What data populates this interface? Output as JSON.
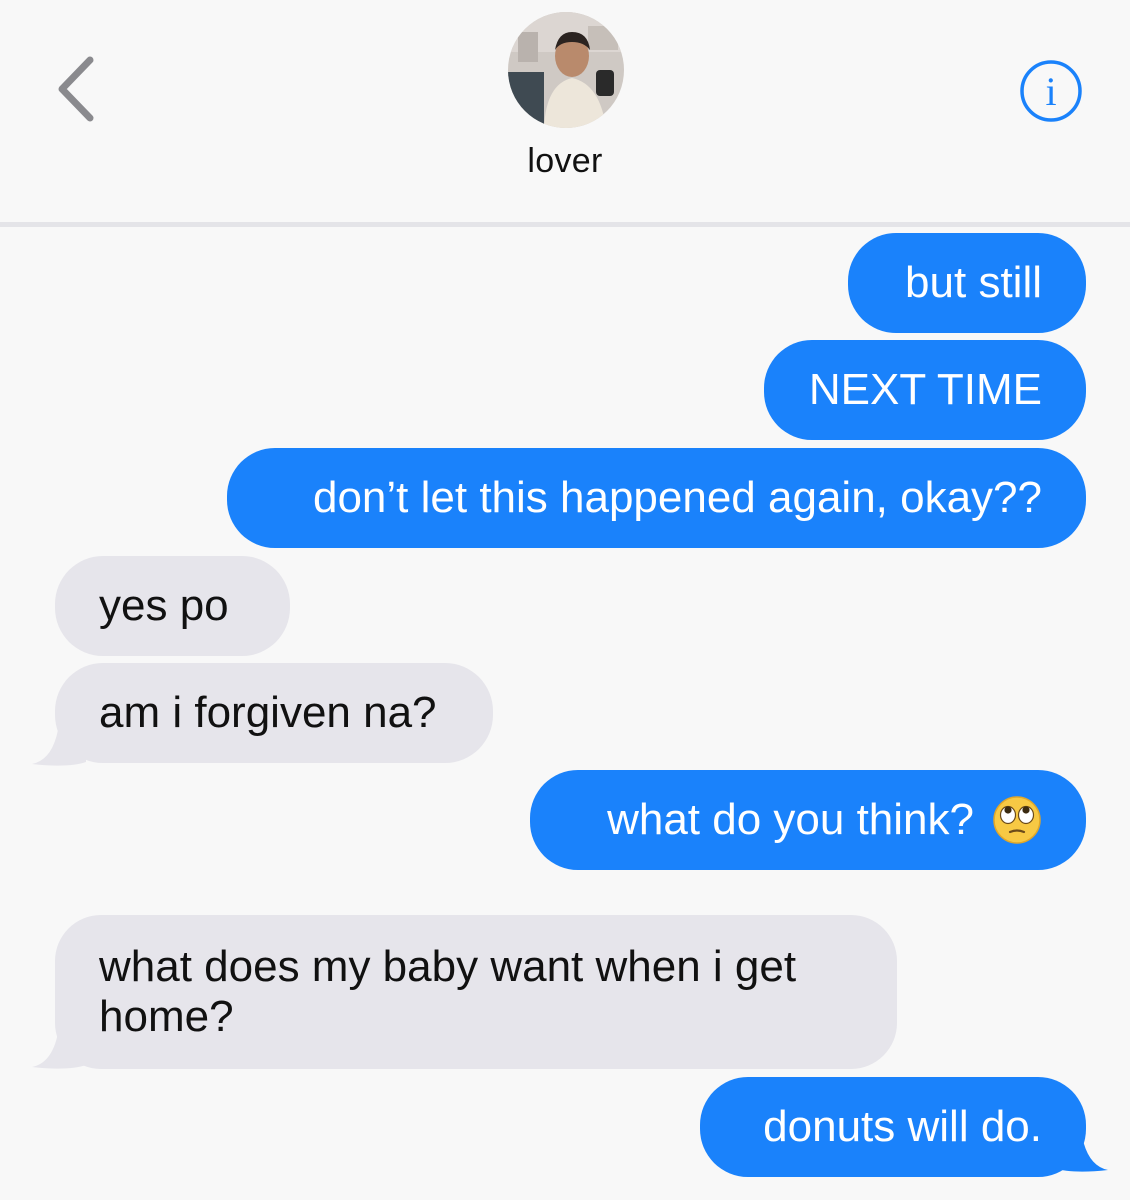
{
  "header": {
    "contact_name": "lover",
    "back_icon": "chevron-left-icon",
    "info_icon": "info-icon",
    "accent_color": "#1a82fb"
  },
  "messages": [
    {
      "direction": "sent",
      "text": "but still"
    },
    {
      "direction": "sent",
      "text": "NEXT TIME"
    },
    {
      "direction": "sent",
      "text": "don’t let this happened again, okay??"
    },
    {
      "direction": "received",
      "text": "yes po"
    },
    {
      "direction": "received",
      "text": "am i forgiven na?"
    },
    {
      "direction": "sent",
      "text": "what do you think?",
      "emoji": "face-with-rolling-eyes-icon"
    },
    {
      "direction": "received",
      "text": "what does my baby want when i get home?"
    },
    {
      "direction": "sent",
      "text": "donuts will do."
    }
  ],
  "colors": {
    "sent_bubble": "#1a82fb",
    "received_bubble": "#e6e5eb",
    "background": "#f8f8f8"
  }
}
